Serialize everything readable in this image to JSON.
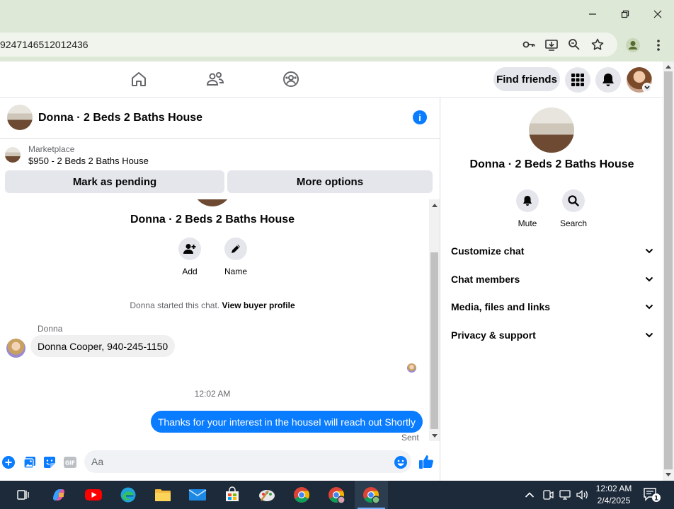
{
  "browser": {
    "url": "9247146512012436"
  },
  "nav": {
    "find_friends": "Find friends"
  },
  "chat": {
    "title": "Donna · 2 Beds 2 Baths House",
    "marketplace_label": "Marketplace",
    "listing": "$950 - 2 Beds 2 Baths House",
    "mark_pending": "Mark as pending",
    "more_options": "More options",
    "center_name": "Donna · 2 Beds 2 Baths House",
    "actions": [
      {
        "label": "Add",
        "icon": "add-person-icon"
      },
      {
        "label": "Name",
        "icon": "pencil-icon"
      }
    ],
    "system_text": "Donna started this chat.",
    "view_profile": "View buyer profile",
    "sender": "Donna",
    "incoming_message": "Donna Cooper, 940-245-1150",
    "timestamp": "12:02 AM",
    "outgoing_message": "Thanks for your interest in the houseI will reach out Shortly",
    "sent_status": "Sent",
    "composer_placeholder": "Aa",
    "accent_color": "#0a7cff"
  },
  "panel": {
    "name": "Donna · 2 Beds 2 Baths House",
    "actions": [
      {
        "label": "Mute",
        "icon": "bell-icon"
      },
      {
        "label": "Search",
        "icon": "search-icon"
      }
    ],
    "sections": [
      {
        "label": "Customize chat"
      },
      {
        "label": "Chat members"
      },
      {
        "label": "Media, files and links"
      },
      {
        "label": "Privacy & support"
      }
    ]
  },
  "taskbar": {
    "time": "12:02 AM",
    "date": "2/4/2025",
    "notification_count": "1"
  }
}
